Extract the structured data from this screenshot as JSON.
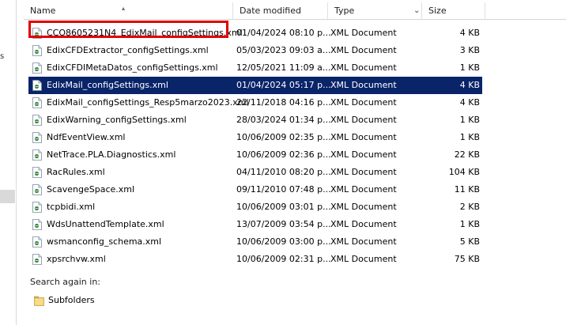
{
  "columns": {
    "name": "Name",
    "date": "Date modified",
    "type": "Type",
    "size": "Size"
  },
  "files": [
    {
      "name": "CCO8605231N4_EdixMail_configSettings.xml",
      "date": "01/04/2024 08:10 p...",
      "type": "XML Document",
      "size": "4 KB"
    },
    {
      "name": "EdixCFDExtractor_configSettings.xml",
      "date": "05/03/2023 09:03 a...",
      "type": "XML Document",
      "size": "3 KB"
    },
    {
      "name": "EdixCFDIMetaDatos_configSettings.xml",
      "date": "12/05/2021 11:09 a...",
      "type": "XML Document",
      "size": "1 KB"
    },
    {
      "name": "EdixMail_configSettings.xml",
      "date": "01/04/2024 05:17 p...",
      "type": "XML Document",
      "size": "4 KB"
    },
    {
      "name": "EdixMail_configSettings_Resp5marzo2023.xml",
      "date": "22/11/2018 04:16 p...",
      "type": "XML Document",
      "size": "4 KB"
    },
    {
      "name": "EdixWarning_configSettings.xml",
      "date": "28/03/2024 01:34 p...",
      "type": "XML Document",
      "size": "1 KB"
    },
    {
      "name": "NdfEventView.xml",
      "date": "10/06/2009 02:35 p...",
      "type": "XML Document",
      "size": "1 KB"
    },
    {
      "name": "NetTrace.PLA.Diagnostics.xml",
      "date": "10/06/2009 02:36 p...",
      "type": "XML Document",
      "size": "22 KB"
    },
    {
      "name": "RacRules.xml",
      "date": "04/11/2010 08:20 p...",
      "type": "XML Document",
      "size": "104 KB"
    },
    {
      "name": "ScavengeSpace.xml",
      "date": "09/11/2010 07:48 p...",
      "type": "XML Document",
      "size": "11 KB"
    },
    {
      "name": "tcpbidi.xml",
      "date": "10/06/2009 03:01 p...",
      "type": "XML Document",
      "size": "2 KB"
    },
    {
      "name": "WdsUnattendTemplate.xml",
      "date": "13/07/2009 03:54 p...",
      "type": "XML Document",
      "size": "1 KB"
    },
    {
      "name": "wsmanconfig_schema.xml",
      "date": "10/06/2009 03:00 p...",
      "type": "XML Document",
      "size": "5 KB"
    },
    {
      "name": "xpsrchvw.xml",
      "date": "10/06/2009 02:31 p...",
      "type": "XML Document",
      "size": "75 KB"
    }
  ],
  "selected_index": 3,
  "highlighted_index": 0,
  "highlight_color": "#e00000",
  "selection_color": "#0a246a",
  "search_again": {
    "label": "Search again in:",
    "subfolders": "Subfolders"
  },
  "icons": {
    "file": "xml-file-icon",
    "folder": "folder-icon"
  }
}
